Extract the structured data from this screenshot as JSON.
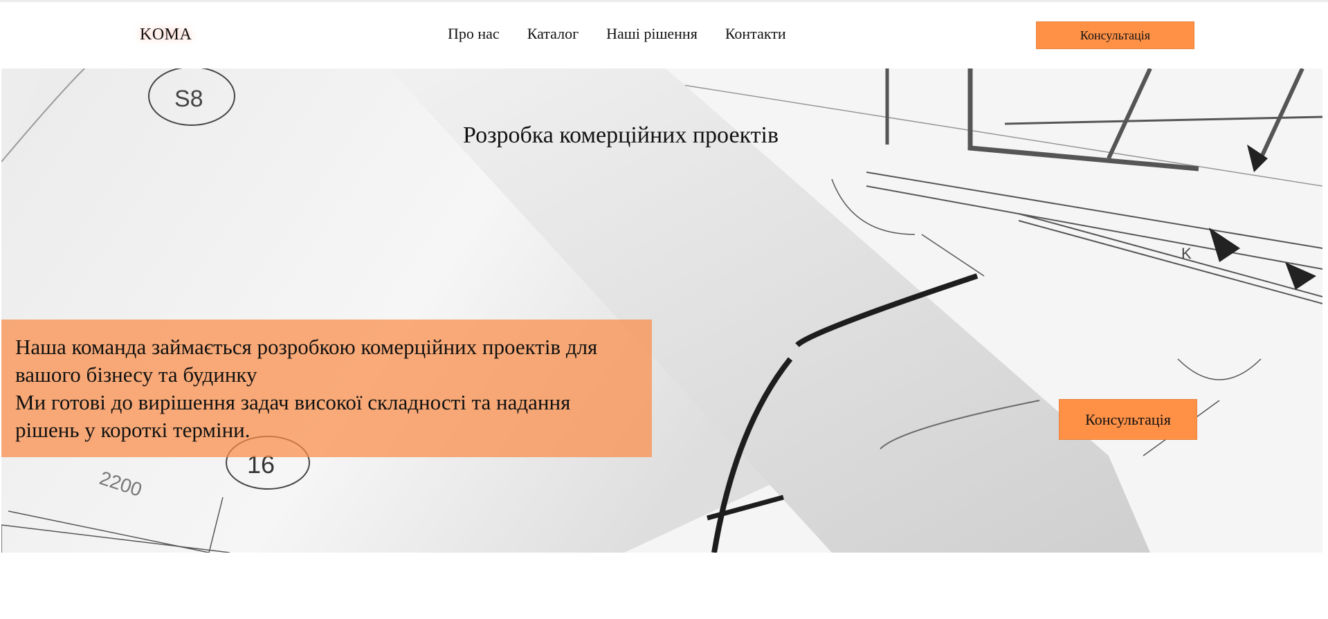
{
  "header": {
    "logo": "KOMA",
    "nav": [
      {
        "label": "Про нас"
      },
      {
        "label": "Каталог"
      },
      {
        "label": "Наші рішення"
      },
      {
        "label": "Контакти"
      }
    ],
    "cta_label": "Консультація"
  },
  "hero": {
    "title": "Розробка комерційних проектів",
    "lines": [
      "Наша команда займається розробкою комерційних проектів для вашого бізнесу та будинку",
      "Ми готові до вирішення задач високої складності та надання рішень у короткі терміни."
    ],
    "cta_label": "Консультація",
    "background_markings": [
      "S8",
      "16",
      "2200",
      "K"
    ]
  },
  "colors": {
    "accent": "#ff9147",
    "overlay": "#fa8c46"
  }
}
